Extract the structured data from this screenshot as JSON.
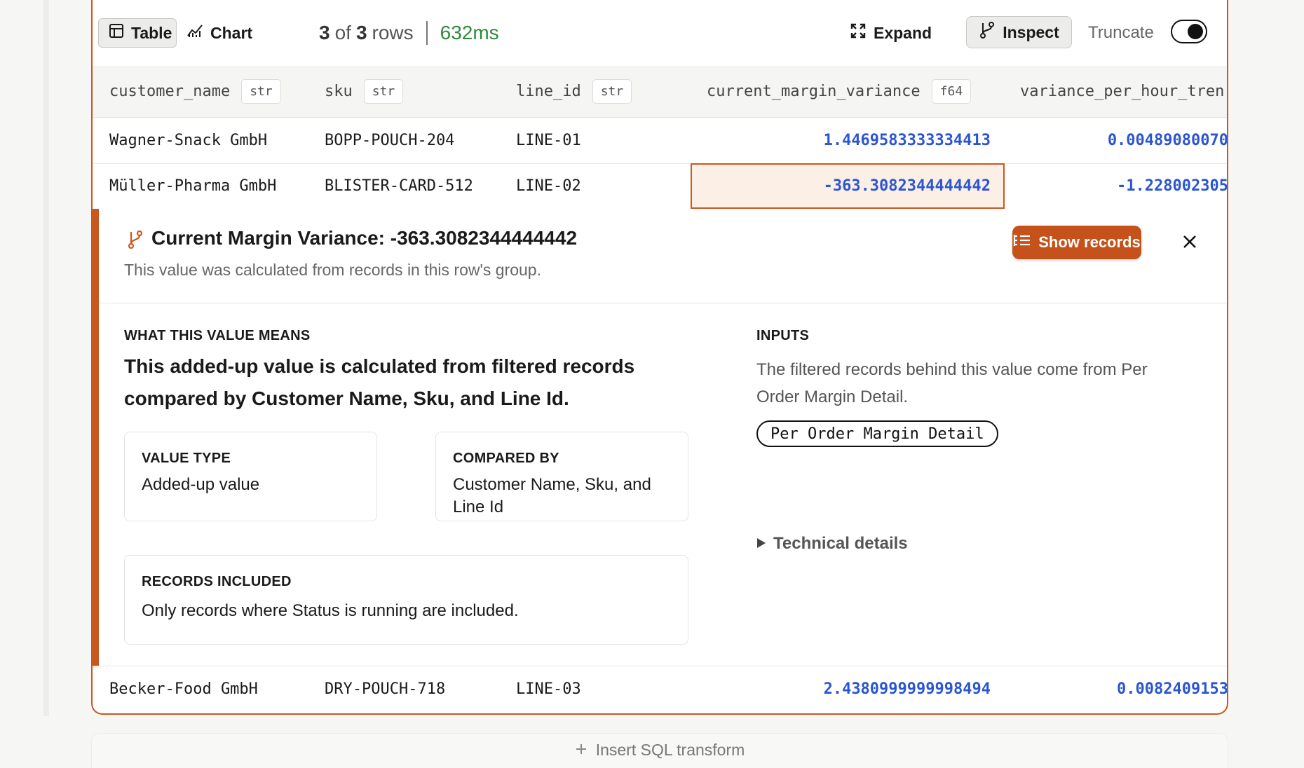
{
  "toolbar": {
    "table_label": "Table",
    "chart_label": "Chart",
    "rows_shown": "3",
    "rows_of": "of",
    "rows_total": "3",
    "rows_word": "rows",
    "timing": "632ms",
    "expand_label": "Expand",
    "inspect_label": "Inspect",
    "truncate_label": "Truncate",
    "truncate_on": true
  },
  "table": {
    "columns": [
      {
        "name": "customer_name",
        "type": "str"
      },
      {
        "name": "sku",
        "type": "str"
      },
      {
        "name": "line_id",
        "type": "str"
      },
      {
        "name": "current_margin_variance",
        "type": "f64"
      },
      {
        "name": "variance_per_hour_tren",
        "type": ""
      }
    ],
    "rows": [
      {
        "customer_name": "Wagner-Snack GmbH",
        "sku": "BOPP-POUCH-204",
        "line_id": "LINE-01",
        "current_margin_variance": "1.4469583333334413",
        "variance_per_hour": "0.00489080070"
      },
      {
        "customer_name": "Müller-Pharma GmbH",
        "sku": "BLISTER-CARD-512",
        "line_id": "LINE-02",
        "current_margin_variance": "-363.3082344444442",
        "variance_per_hour": "-1.228002305"
      },
      {
        "customer_name": "Becker-Food GmbH",
        "sku": "DRY-POUCH-718",
        "line_id": "LINE-03",
        "current_margin_variance": "2.4380999999998494",
        "variance_per_hour": "0.0082409153"
      }
    ]
  },
  "inspect": {
    "title": "Current Margin Variance: -363.3082344444442",
    "subtitle": "This value was calculated from records in this row's group.",
    "show_records_label": "Show records",
    "meaning_label": "WHAT THIS VALUE MEANS",
    "meaning_text": "This added-up value is calculated from filtered records compared by Customer Name, Sku, and Line Id.",
    "value_type_label": "VALUE TYPE",
    "value_type": "Added-up value",
    "compared_by_label": "COMPARED BY",
    "compared_by": "Customer Name, Sku, and Line Id",
    "records_label": "RECORDS INCLUDED",
    "records_text": "Only records where Status is running are included.",
    "inputs_label": "INPUTS",
    "inputs_text": "The filtered records behind this value come from Per Order Margin Detail.",
    "source_chip": "Per Order Margin Detail",
    "technical_details": "Technical details"
  },
  "footer": {
    "insert_sql_label": "Insert SQL transform"
  },
  "colors": {
    "accent": "#c9581f",
    "number": "#2b55d1",
    "timing": "#2f8a3a"
  },
  "icons": [
    "table-icon",
    "chart-icon",
    "expand-icon",
    "inspect-icon",
    "branch-icon",
    "list-icon",
    "close-icon",
    "caret-right-icon",
    "plus-icon"
  ]
}
